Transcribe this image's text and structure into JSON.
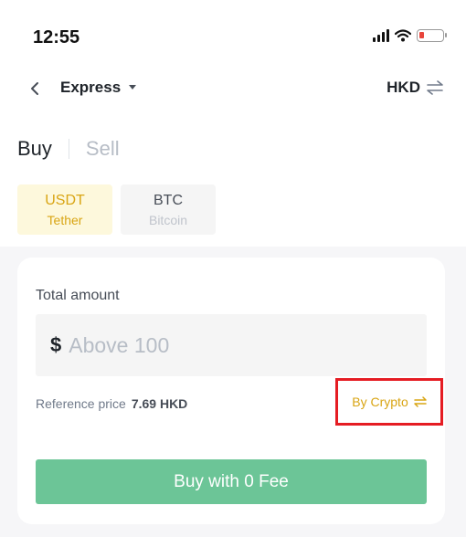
{
  "status_bar": {
    "time": "12:55"
  },
  "nav": {
    "mode_label": "Express",
    "fiat_label": "HKD"
  },
  "tabs": [
    {
      "label": "Buy",
      "active": true
    },
    {
      "label": "Sell",
      "active": false
    }
  ],
  "coins": [
    {
      "symbol": "USDT",
      "name": "Tether",
      "selected": true
    },
    {
      "symbol": "BTC",
      "name": "Bitcoin",
      "selected": false
    }
  ],
  "card": {
    "total_label": "Total amount",
    "currency_symbol": "$",
    "amount_placeholder": "Above 100",
    "amount_value": "",
    "reference_label": "Reference price",
    "reference_value": "7.69 HKD",
    "toggle_label": "By Crypto",
    "buy_button_label": "Buy with 0 Fee"
  },
  "colors": {
    "accent": "#d9a514",
    "buy_button": "#6cc597",
    "highlight_box": "#e51c23"
  }
}
